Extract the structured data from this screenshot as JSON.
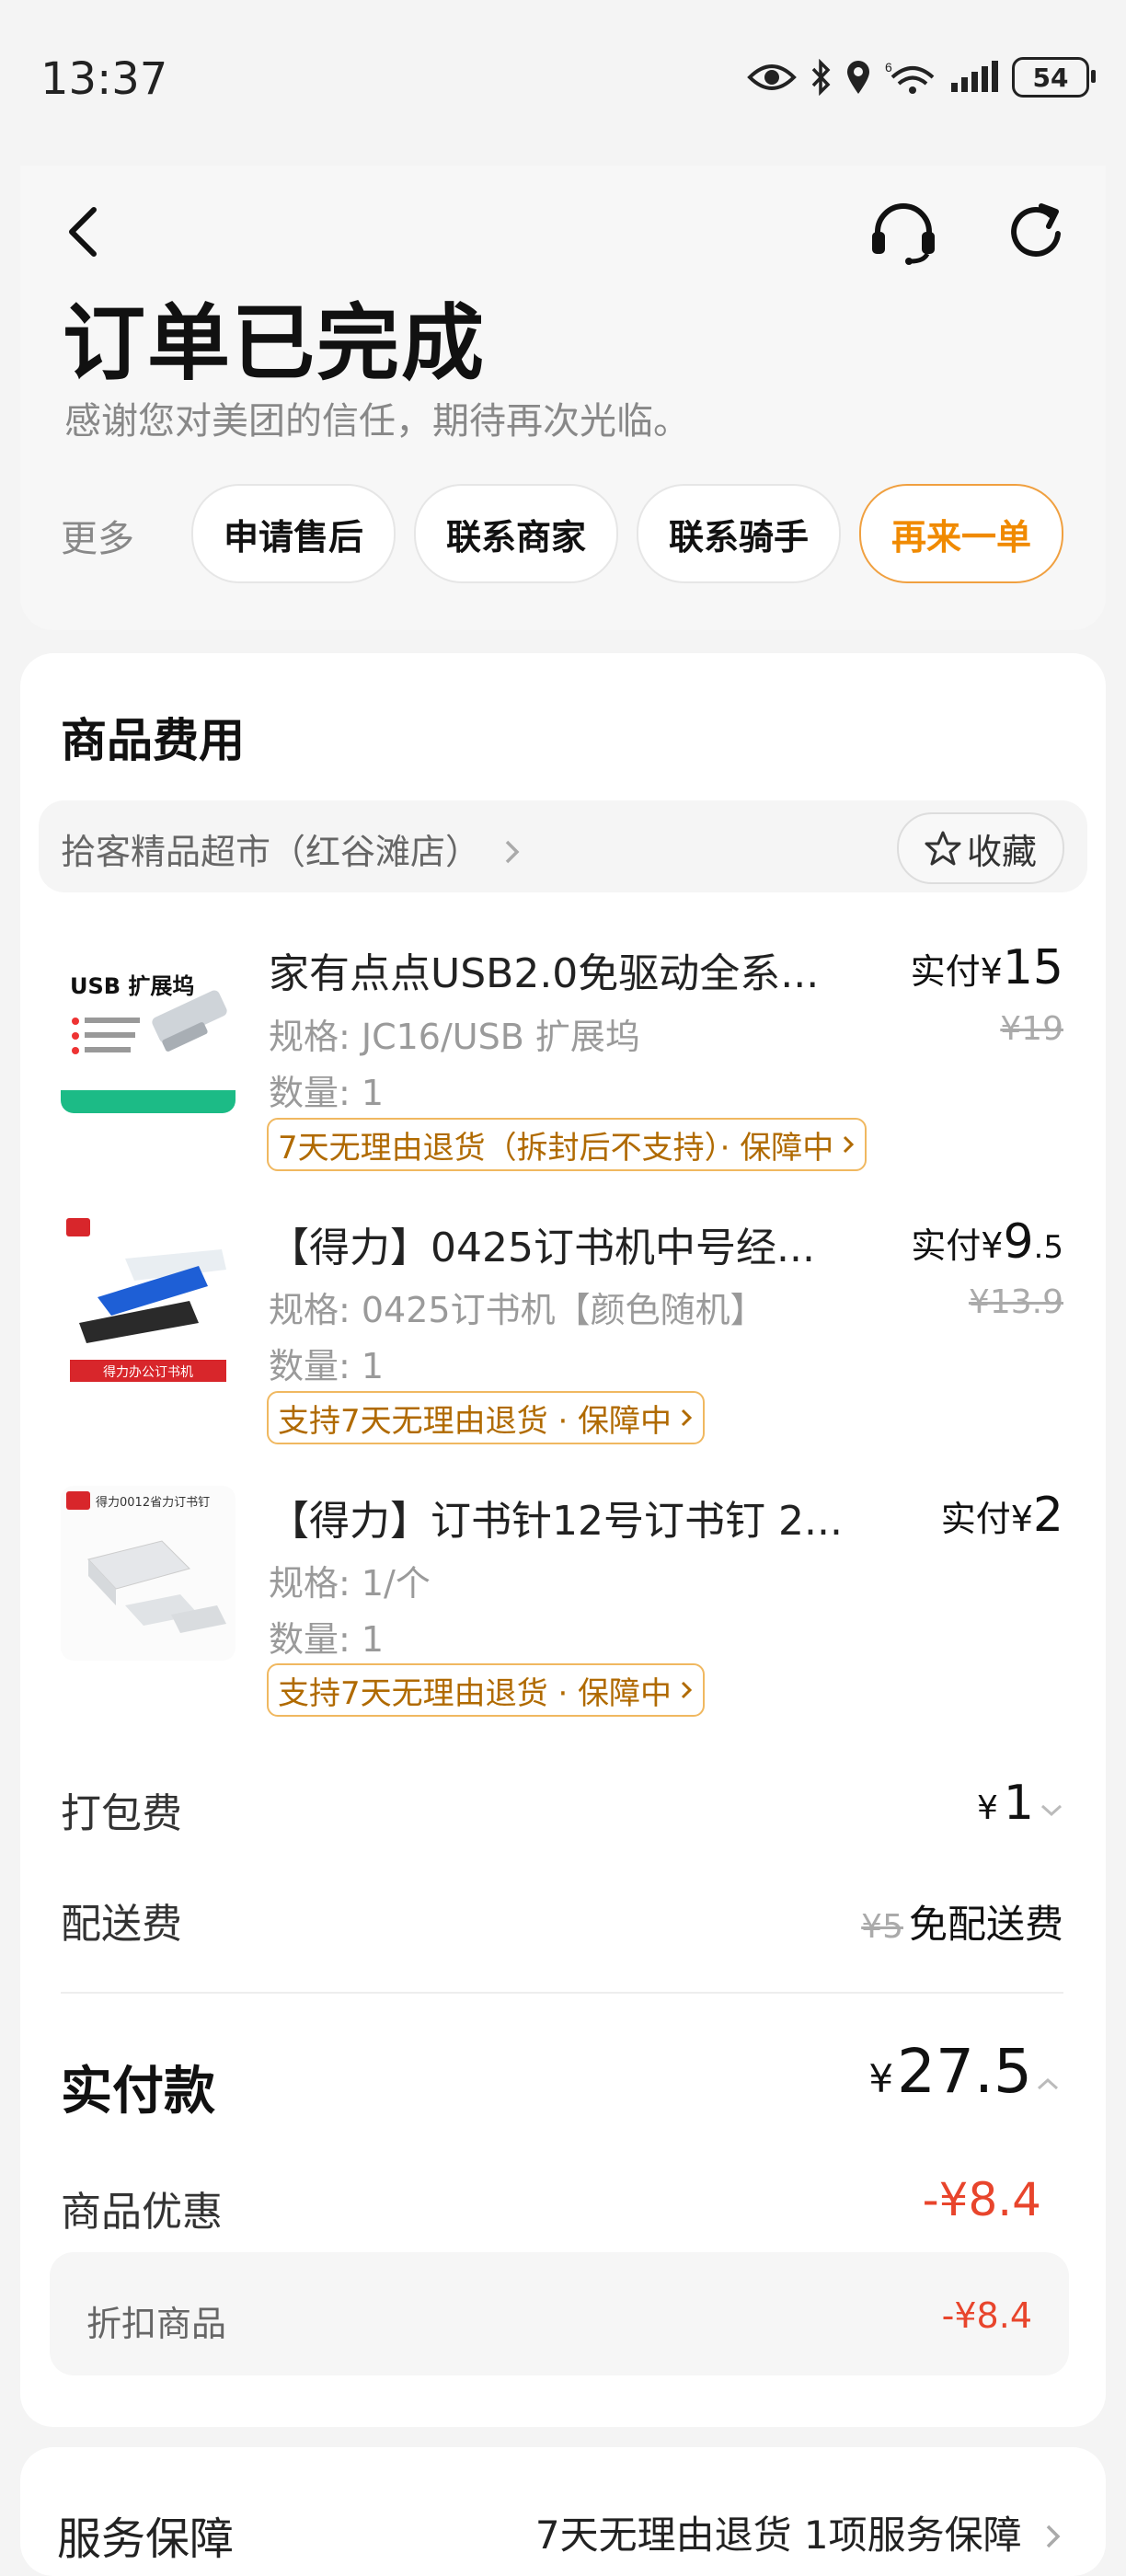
{
  "status_bar": {
    "time": "13:37",
    "battery": "54",
    "icons": [
      "eye-icon",
      "bluetooth-icon",
      "location-icon",
      "wifi-icon",
      "signal-icon",
      "battery-icon"
    ]
  },
  "header": {
    "title": "订单已完成",
    "subtitle": "感谢您对美团的信任，期待再次光临。",
    "more_label": "更多",
    "actions": [
      "申请售后",
      "联系商家",
      "联系骑手",
      "再来一单"
    ]
  },
  "goods": {
    "section_title": "商品费用",
    "store_name": "拾客精品超市（红谷滩店）",
    "favorite_label": "收藏",
    "items": [
      {
        "name": "家有点点USB2.0免驱动全系...",
        "spec": "规格: JC16/USB 扩展坞",
        "qty": "数量: 1",
        "tag": "7天无理由退货（拆封后不支持）· 保障中",
        "paid_label": "实付",
        "currency": "¥",
        "price_int": "15",
        "price_dec": "",
        "original": "¥19",
        "thumb_text": "USB扩展坞"
      },
      {
        "name": "【得力】0425订书机中号经...",
        "spec": "规格: 0425订书机【颜色随机】",
        "qty": "数量: 1",
        "tag": "支持7天无理由退货 · 保障中",
        "paid_label": "实付",
        "currency": "¥",
        "price_int": "9",
        "price_dec": ".5",
        "original": "¥13.9",
        "thumb_text": "得力办公订书机"
      },
      {
        "name": "【得力】订书针12号订书钉  2...",
        "spec": "规格: 1/个",
        "qty": "数量: 1",
        "tag": "支持7天无理由退货 · 保障中",
        "paid_label": "实付",
        "currency": "¥",
        "price_int": "2",
        "price_dec": "",
        "original": "",
        "thumb_text": "得力0012省力订书钉"
      }
    ]
  },
  "fees": {
    "packing_label": "打包费",
    "packing_currency": "¥",
    "packing_value": "1",
    "delivery_label": "配送费",
    "delivery_original": "¥5",
    "delivery_value": "免配送费"
  },
  "total": {
    "label": "实付款",
    "currency": "¥",
    "value": "27.5"
  },
  "discount": {
    "label": "商品优惠",
    "value": "-¥8.4",
    "sub_label": "折扣商品",
    "sub_value": "-¥8.4"
  },
  "service": {
    "label": "服务保障",
    "value": "7天无理由退货 1项服务保障"
  },
  "colors": {
    "accent": "#f08a00",
    "discount_red": "#e8452c",
    "tag_brown": "#b06a00"
  }
}
